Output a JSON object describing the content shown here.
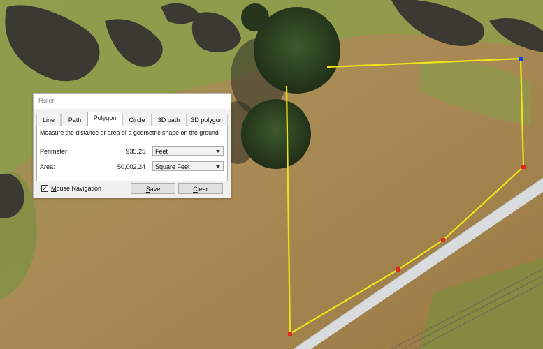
{
  "dialog": {
    "title": "Ruler",
    "tabs": [
      "Line",
      "Path",
      "Polygon",
      "Circle",
      "3D path",
      "3D polygon"
    ],
    "active_tab": "Polygon",
    "description": "Measure the distance or area of a geometric shape on the ground",
    "perimeter": {
      "label": "Perimeter:",
      "value": "935.25",
      "unit": "Feet"
    },
    "area": {
      "label": "Area:",
      "value": "50,002.24",
      "unit": "Square Feet"
    },
    "mouse_navigation": {
      "label_first": "M",
      "label_rest": "ouse Navigation",
      "checked": true,
      "mark": "✓"
    },
    "save": {
      "first": "S",
      "rest": "ave"
    },
    "clear": {
      "first": "C",
      "rest": "lear"
    }
  },
  "colors": {
    "polygon_line": "#f0e21a",
    "vertex_red": "#e0281c",
    "vertex_blue": "#1a3fe0",
    "grass": "#8c9a45",
    "dry_field": "#a8874e",
    "path": "#d8dcdf"
  }
}
